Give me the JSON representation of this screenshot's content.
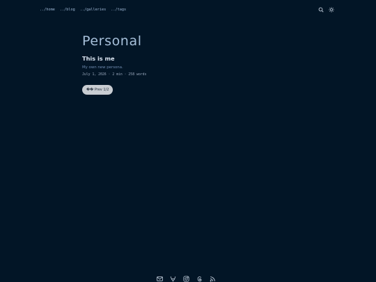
{
  "nav": {
    "items": [
      {
        "label": "../home"
      },
      {
        "label": "../blog"
      },
      {
        "label": "../galleries"
      },
      {
        "label": "../tags"
      }
    ]
  },
  "header_icons": [
    "search-icon",
    "sun-icon"
  ],
  "post": {
    "title": "Personal",
    "entry_title": "This is me",
    "entry_description": "My own new persona.",
    "meta": "July 1, 2026 · 2 min · 258 words",
    "prev_label": "�� Prev 1/2"
  },
  "footer_icons": [
    "mail-icon",
    "gitlab-icon",
    "instagram-icon",
    "threads-icon",
    "rss-icon"
  ],
  "colors": {
    "background": "#021526",
    "nav_text": "#9fb8d6",
    "title": "#a7c0da",
    "button_bg": "#c9cdd2"
  }
}
